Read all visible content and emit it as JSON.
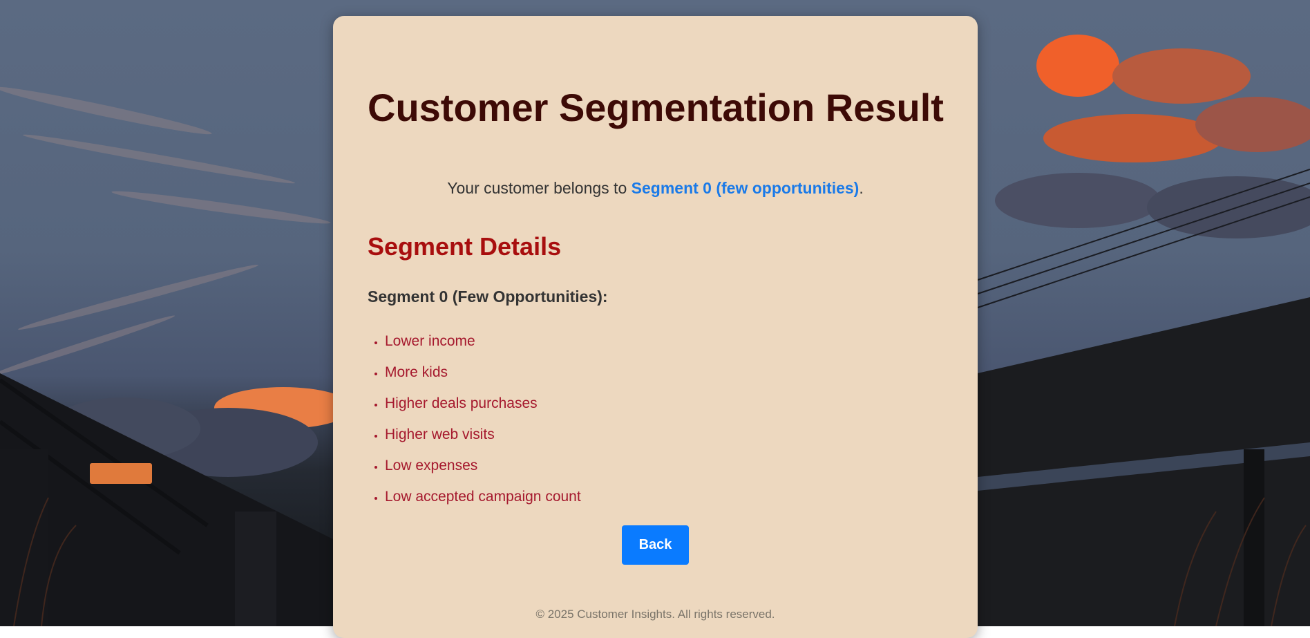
{
  "page": {
    "title": "Customer Segmentation Result",
    "result_prefix": "Your customer belongs to ",
    "result_segment": "Segment 0 (few opportunities)",
    "result_suffix": ".",
    "details_heading": "Segment Details",
    "segment_name": "Segment 0 (Few Opportunities):",
    "traits": [
      "Lower income",
      "More kids",
      "Higher deals purchases",
      "Higher web visits",
      "Low expenses",
      "Low accepted campaign count"
    ],
    "back_label": "Back",
    "footer": "© 2025 Customer Insights. All rights reserved."
  },
  "colors": {
    "card_bg": "#edd8bf",
    "title": "#3d0a06",
    "accent_link": "#1a7ae8",
    "heading_red": "#a80e0e",
    "trait_red": "#a5182d",
    "button_blue": "#0a7bff"
  },
  "background": {
    "description_icon": "sunset-landscape-illustration"
  }
}
